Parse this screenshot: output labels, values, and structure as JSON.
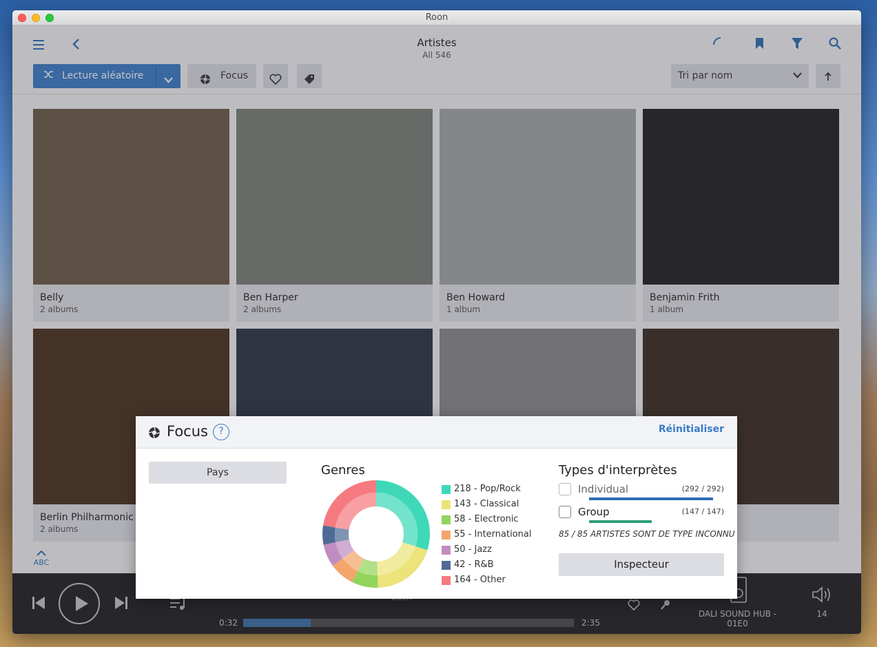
{
  "window": {
    "title": "Roon"
  },
  "header": {
    "title": "Artistes",
    "subtitle": "All 546",
    "shuffle_label": "Lecture aléatoire",
    "focus_label": "Focus",
    "sort_label": "Tri par nom"
  },
  "artists": [
    {
      "name": "Belly",
      "count": "2 albums",
      "color": "#6b5a45"
    },
    {
      "name": "Ben Harper",
      "count": "2 albums",
      "color": "#7a7e76"
    },
    {
      "name": "Ben Howard",
      "count": "1 album",
      "color": "#a4a8a4"
    },
    {
      "name": "Benjamin Frith",
      "count": "1 album",
      "color": "#1e1e20"
    },
    {
      "name": "Berlin Philharmonic",
      "count": "2 albums",
      "color": "#4a2e1a"
    },
    {
      "name": "",
      "count": "",
      "color": "#2a3240"
    },
    {
      "name": "",
      "count": "",
      "color": "#8a8a8a"
    },
    {
      "name": "",
      "count": "",
      "color": "#3a2a20"
    }
  ],
  "sidebar": {
    "abc_label": "ABC"
  },
  "player": {
    "track": "Lush",
    "time_elapsed": "0:32",
    "time_total": "2:35",
    "zone_name": "DALI SOUND HUB - 01E0",
    "volume": "14"
  },
  "focus": {
    "title": "Focus",
    "help": "?",
    "reset_label": "Réinitialiser",
    "country_label": "Pays",
    "genres_title": "Genres",
    "types_title": "Types d'interprètes",
    "types": [
      {
        "label": "Individual",
        "count": "(292 / 292)",
        "color": "#2c6fb5",
        "fraction": 1.0
      },
      {
        "label": "Group",
        "count": "(147 / 147)",
        "color": "#2f9e78",
        "fraction": 0.503
      }
    ],
    "unknown_text": "85 / 85 ARTISTES SONT DE TYPE INCONNU",
    "inspect_label": "Inspecteur"
  },
  "chart_data": {
    "type": "pie",
    "categories": [
      "Pop/Rock",
      "Classical",
      "Electronic",
      "International",
      "Jazz",
      "R&B",
      "Other"
    ],
    "values": [
      218,
      143,
      58,
      55,
      50,
      42,
      164
    ],
    "labels": [
      "218 - Pop/Rock",
      "143 - Classical",
      "58 - Electronic",
      "55 - International",
      "50 - Jazz",
      "42 - R&B",
      "164 - Other"
    ],
    "colors": [
      "#3ed8b8",
      "#ece37a",
      "#93d45a",
      "#f4a56a",
      "#c18dc0",
      "#4f6a96",
      "#f57a7f"
    ],
    "title": "Genres"
  }
}
